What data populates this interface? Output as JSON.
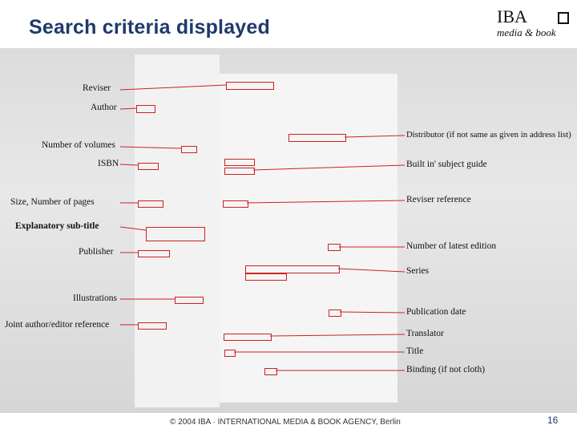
{
  "header": {
    "title": "Search criteria displayed",
    "brand": "IBA",
    "brand_tagline": "media & book"
  },
  "left_labels": [
    "Reviser",
    "Author",
    "Number of volumes",
    "ISBN",
    "Size, Number of pages",
    "Explanatory sub-title",
    "Publisher",
    "Illustrations",
    "Joint author/editor reference"
  ],
  "right_labels": [
    "Distributor (if not same as given in address list)",
    "Built in' subject guide",
    "Reviser reference",
    "Number of latest edition",
    "Series",
    "Publication date",
    "Translator",
    "Title",
    "Binding (if not cloth)"
  ],
  "footer": {
    "copyright": "© 2004 IBA · INTERNATIONAL MEDIA & BOOK AGENCY, Berlin",
    "page_number": "16"
  },
  "colors": {
    "title": "#1f3a6b",
    "highlight": "#d02020",
    "connector": "#d02020"
  }
}
